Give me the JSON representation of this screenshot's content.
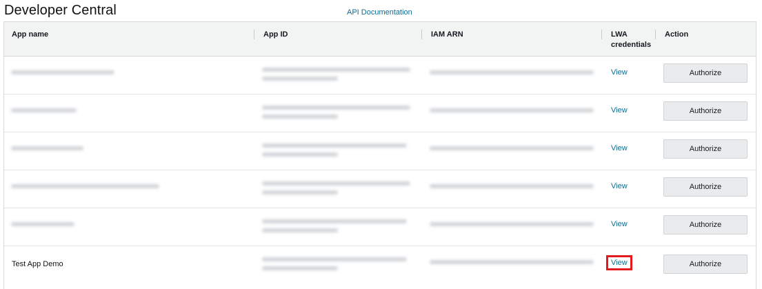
{
  "header": {
    "title": "Developer Central",
    "api_doc_link": "API Documentation"
  },
  "table": {
    "columns": [
      "App name",
      "App ID",
      "IAM ARN",
      "LWA credentials",
      "Action"
    ],
    "lwa_header_line1": "LWA",
    "lwa_header_line2": "credentials",
    "rows": [
      {
        "app_name": "",
        "blurred": true,
        "lwa": "View",
        "action": "Authorize"
      },
      {
        "app_name": "",
        "blurred": true,
        "lwa": "View",
        "action": "Authorize"
      },
      {
        "app_name": "",
        "blurred": true,
        "lwa": "View",
        "action": "Authorize"
      },
      {
        "app_name": "",
        "blurred": true,
        "lwa": "View",
        "action": "Authorize"
      },
      {
        "app_name": "",
        "blurred": true,
        "lwa": "View",
        "action": "Authorize"
      },
      {
        "app_name": "Test App Demo",
        "blurred": false,
        "lwa": "View",
        "action": "Authorize",
        "highlighted_view": true
      }
    ]
  },
  "colors": {
    "link": "#0f6b8f",
    "highlight": "#e3191c",
    "header_bg": "#f2f3f3",
    "button_bg": "#e9ebed"
  }
}
